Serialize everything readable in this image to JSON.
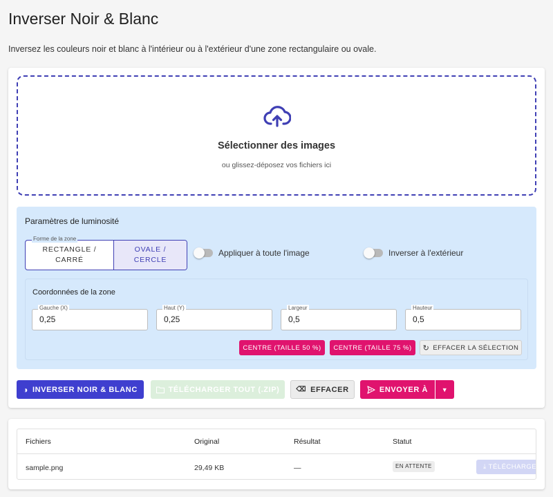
{
  "page": {
    "title": "Inverser Noir & Blanc",
    "description": "Inversez les couleurs noir et blanc à l'intérieur ou à l'extérieur d'une zone rectangulaire ou ovale."
  },
  "dropzone": {
    "icon": "cloud-upload-icon",
    "title": "Sélectionner des images",
    "subtitle": "ou glissez-déposez vos fichiers ici"
  },
  "settings": {
    "title": "Paramètres de luminosité",
    "shape": {
      "legend": "Forme de la zone",
      "rect_label": "RECTANGLE / CARRÉ",
      "oval_label": "OVALE / CERCLE",
      "selected": "oval"
    },
    "apply_full_label": "Appliquer à toute l'image",
    "apply_full_on": false,
    "invert_outside_label": "Inverser à l'extérieur",
    "invert_outside_on": false,
    "coords": {
      "title": "Coordonnées de la zone",
      "left_label": "Gauche (X)",
      "left_value": "0,25",
      "top_label": "Haut (Y)",
      "top_value": "0,25",
      "width_label": "Largeur",
      "width_value": "0,5",
      "height_label": "Hauteur",
      "height_value": "0,5"
    },
    "center50_label": "CENTRE (TAILLE 50 %)",
    "center75_label": "CENTRE (TAILLE 75 %)",
    "clear_selection_label": "EFFACER LA SÉLECTION"
  },
  "actions": {
    "invert_label": "INVERSER NOIR & BLANC",
    "download_all_label": "TÉLÉCHARGER TOUT (.ZIP)",
    "clear_label": "EFFACER",
    "send_label": "ENVOYER À"
  },
  "table": {
    "headers": [
      "Fichiers",
      "Original",
      "Résultat",
      "Statut"
    ],
    "rows": [
      {
        "file": "sample.png",
        "original": "29,49 KB",
        "result": "—",
        "status": "EN ATTENTE",
        "download_label": "TÉLÉCHARGER"
      }
    ]
  },
  "colors": {
    "primary": "#3f3fcf",
    "accent": "#e0136e",
    "settings_bg": "#d6e9fc"
  }
}
